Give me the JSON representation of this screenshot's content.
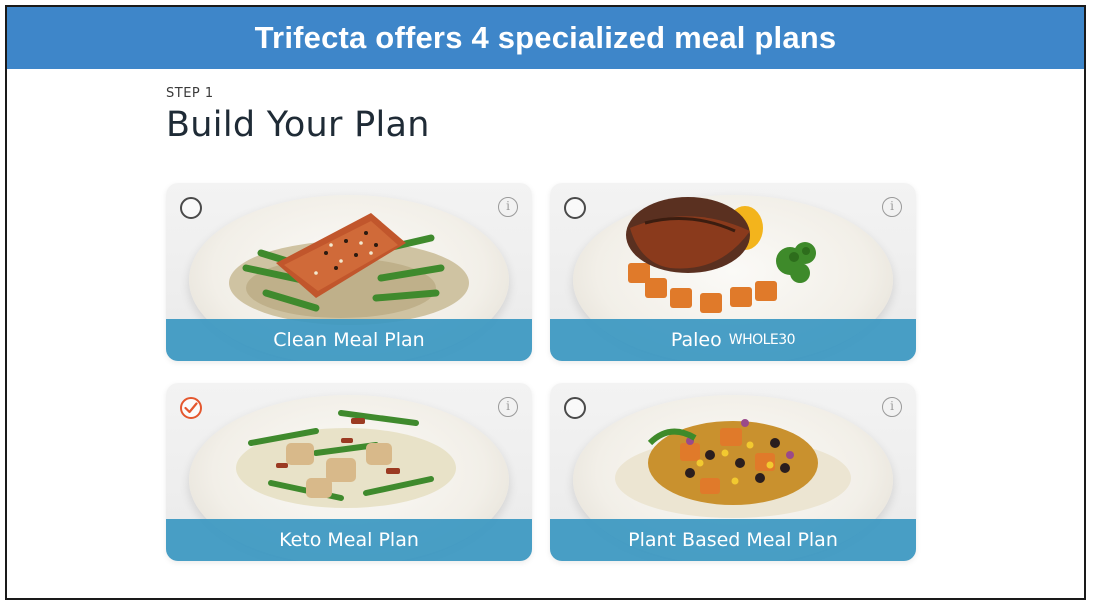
{
  "banner": {
    "title": "Trifecta offers 4 specialized meal plans"
  },
  "step_label": "STEP 1",
  "heading": "Build Your Plan",
  "plans": [
    {
      "label": "Clean Meal Plan",
      "selected": false,
      "image": "salmon-green-beans-quinoa"
    },
    {
      "label": "Paleo",
      "badge": "WHOLE30",
      "selected": false,
      "image": "burger-patty-sweet-potato-broccoli"
    },
    {
      "label": "Keto Meal Plan",
      "selected": true,
      "image": "chicken-green-beans-bacon"
    },
    {
      "label": "Plant Based Meal Plan",
      "selected": false,
      "image": "black-beans-corn-rice-bowl"
    }
  ],
  "icons": {
    "radio": "radio-icon",
    "selected": "check-circle-icon",
    "info": "info-icon"
  },
  "colors": {
    "banner": "#3e86c9",
    "label_bar": "#3b98c2",
    "selected": "#e4572e"
  }
}
